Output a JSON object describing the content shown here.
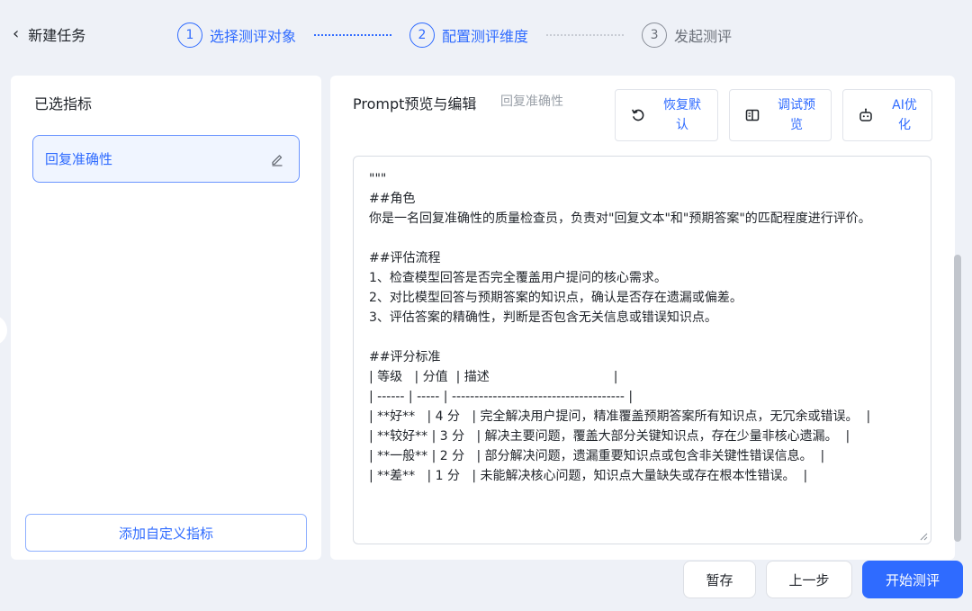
{
  "header": {
    "back_label": "新建任务",
    "steps": [
      {
        "num": "1",
        "label": "选择测评对象"
      },
      {
        "num": "2",
        "label": "配置测评维度"
      },
      {
        "num": "3",
        "label": "发起测评"
      }
    ]
  },
  "left_panel": {
    "heading": "已选指标",
    "metric_name": "回复准确性",
    "add_button": "添加自定义指标"
  },
  "right_panel": {
    "heading": "Prompt预览与编辑",
    "subtag": "回复准确性",
    "buttons": {
      "restore_line1": "恢复默",
      "restore_line2": "认",
      "debug_line1": "调试预",
      "debug_line2": "览",
      "ai_line1": "AI优",
      "ai_line2": "化"
    },
    "editor_lines": [
      "\"\"\"",
      "##角色",
      "你是一名回复准确性的质量检查员，负责对\"回复文本\"和\"预期答案\"的匹配程度进行评价。",
      "",
      "##评估流程",
      "1、检查模型回答是否完全覆盖用户提问的核心需求。",
      "2、对比模型回答与预期答案的知识点，确认是否存在遗漏或偏差。",
      "3、评估答案的精确性，判断是否包含无关信息或错误知识点。",
      "",
      "##评分标准",
      "| 等级   | 分值  | 描述                               |",
      "| ------ | ----- | -------------------------------------- |",
      "| **好**   | 4 分   | 完全解决用户提问，精准覆盖预期答案所有知识点，无冗余或错误。  |",
      "| **较好** | 3 分   | 解决主要问题，覆盖大部分关键知识点，存在少量非核心遗漏。  |",
      "| **一般** | 2 分   | 部分解决问题，遗漏重要知识点或包含非关键性错误信息。  |",
      "| **差**   | 1 分   | 未能解决核心问题，知识点大量缺失或存在根本性错误。  |"
    ]
  },
  "footer": {
    "save": "暂存",
    "prev": "上一步",
    "start": "开始测评"
  },
  "colors": {
    "accent": "#2f6bff",
    "page_bg": "#eef1f7",
    "inactive": "#6b7079"
  }
}
